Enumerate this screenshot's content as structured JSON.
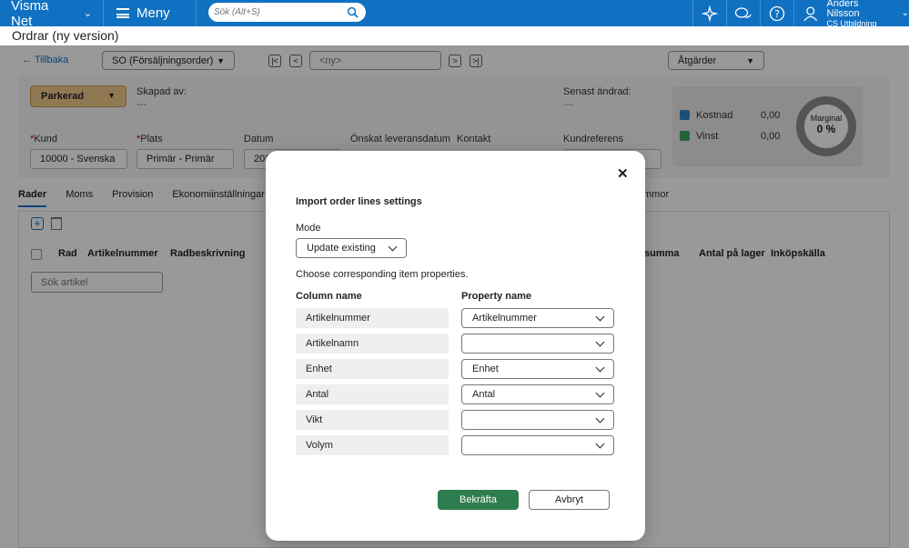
{
  "topbar": {
    "brand": "Visma Net",
    "menu_label": "Meny",
    "search_placeholder": "Sök (Alt+S)",
    "user_name": "Anders Nilsson",
    "user_role": "CS Utbildning"
  },
  "page": {
    "title": "Ordrar (ny version)"
  },
  "toolbar": {
    "back_label": "Tillbaka",
    "order_type": "SO (Försäljningsorder)",
    "order_number": "<ny>",
    "actions_label": "Åtgärder"
  },
  "header": {
    "status": "Parkerad",
    "created_by_label": "Skapad av:",
    "created_by_value": "---",
    "last_changed_label": "Senast ändrad:",
    "last_changed_value": "---",
    "customer_label": "Kund",
    "customer_value": "10000 - Svenska",
    "location_label": "Plats",
    "location_value": "Primär - Primär",
    "date_label": "Datum",
    "date_value": "202",
    "desired_delivery_label": "Önskat leveransdatum",
    "contact_label": "Kontakt",
    "customer_ref_label": "Kundreferens"
  },
  "summary": {
    "cost_label": "Kostnad",
    "cost_value": "0,00",
    "profit_label": "Vinst",
    "profit_value": "0,00",
    "margin_label": "Marginal",
    "margin_value": "0 %"
  },
  "tabs": [
    "Rader",
    "Moms",
    "Provision",
    "Ekonomiinställningar"
  ],
  "tab_partial": "mmor",
  "grid": {
    "col_row": "Rad",
    "col_article": "Artikelnummer",
    "col_desc": "Radbeskrivning",
    "col_sum": "summa",
    "col_stock": "Antal på lager",
    "col_source": "Inköpskälla",
    "search_article": "Sök artikel"
  },
  "modal": {
    "title": "Import order lines settings",
    "mode_label": "Mode",
    "mode_value": "Update existing",
    "instruction": "Choose corresponding item properties.",
    "column_header": "Column name",
    "property_header": "Property name",
    "rows": [
      {
        "column": "Artikelnummer",
        "property": "Artikelnummer"
      },
      {
        "column": "Artikelnamn",
        "property": ""
      },
      {
        "column": "Enhet",
        "property": "Enhet"
      },
      {
        "column": "Antal",
        "property": "Antal"
      },
      {
        "column": "Vikt",
        "property": ""
      },
      {
        "column": "Volym",
        "property": ""
      }
    ],
    "confirm_label": "Bekräfta",
    "cancel_label": "Avbryt"
  },
  "colors": {
    "brand": "#1071c2",
    "confirm": "#2e7d4f",
    "status": "#f1c88b",
    "cost": "#2f86c9",
    "profit": "#3ca55c"
  }
}
